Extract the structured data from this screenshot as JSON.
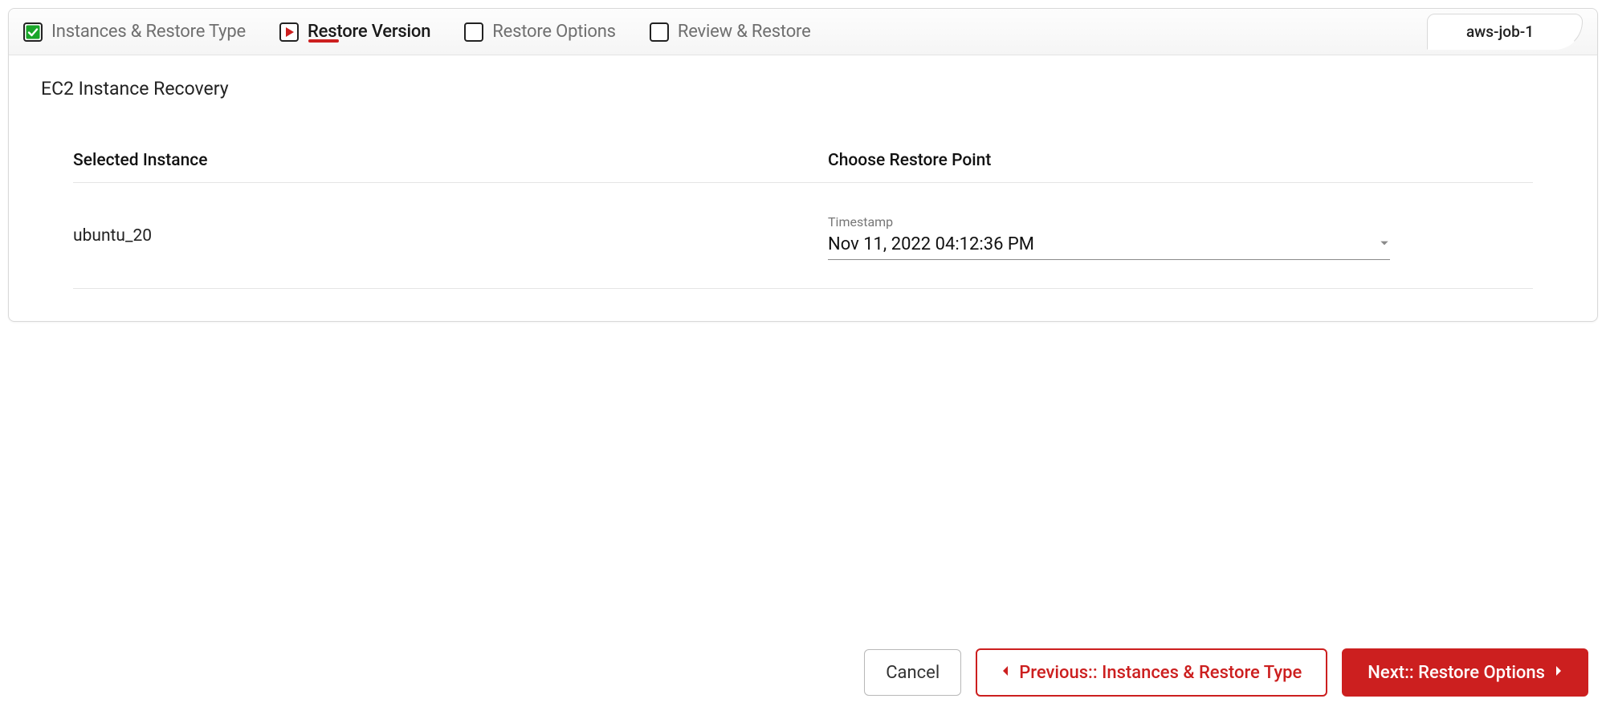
{
  "job_name": "aws-job-1",
  "wizard": {
    "steps": [
      {
        "label": "Instances & Restore Type",
        "state": "done"
      },
      {
        "label": "Restore Version",
        "state": "active"
      },
      {
        "label": "Restore Options",
        "state": "pending"
      },
      {
        "label": "Review & Restore",
        "state": "pending"
      }
    ]
  },
  "page_title": "EC2 Instance Recovery",
  "columns": {
    "selected_instance": "Selected Instance",
    "choose_restore_point": "Choose Restore Point"
  },
  "row": {
    "instance_name": "ubuntu_20",
    "timestamp_label": "Timestamp",
    "timestamp_value": "Nov 11, 2022 04:12:36 PM"
  },
  "buttons": {
    "cancel": "Cancel",
    "previous": "Previous:: Instances & Restore Type",
    "next": "Next:: Restore Options"
  }
}
